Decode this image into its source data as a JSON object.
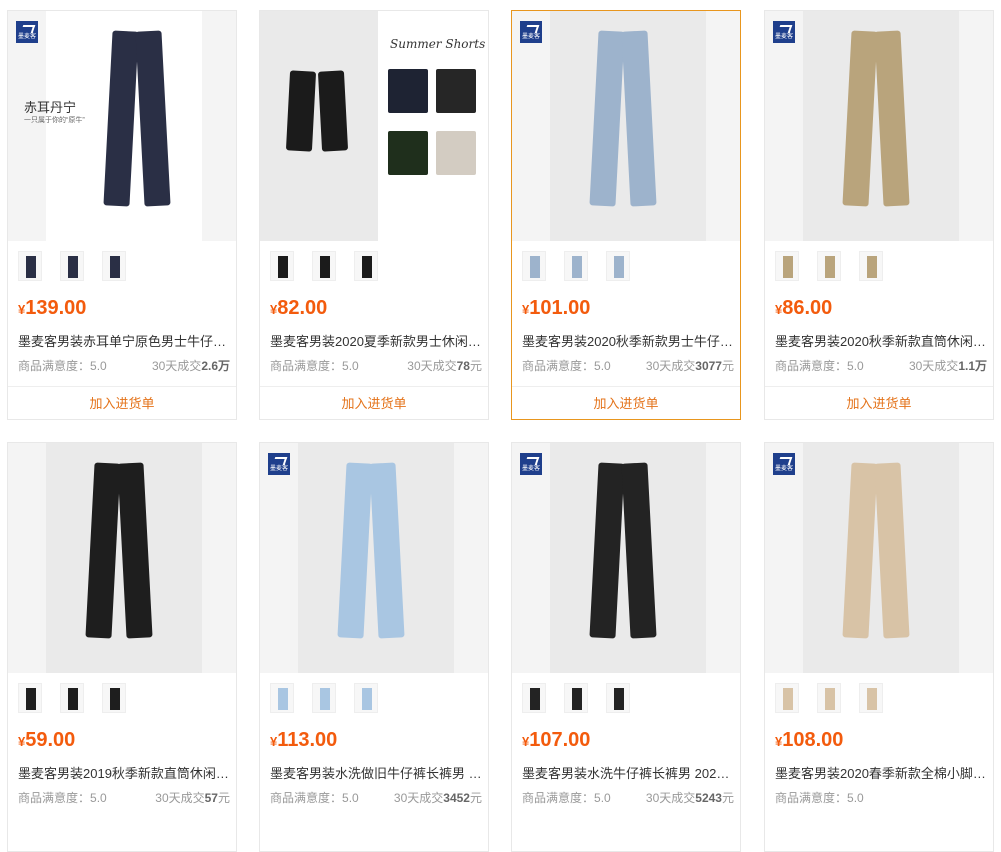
{
  "products": [
    {
      "price_symbol": "¥",
      "price": "139.00",
      "title": "墨麦客男装赤耳单宁原色男士牛仔裤 ...",
      "satisfaction_label": "商品满意度：",
      "satisfaction": "5.0",
      "sales_prefix": "30天成交",
      "sales": "2.6万",
      "sales_suffix": "",
      "button": "加入进货单",
      "photo_text_1": "赤耳丹宁",
      "photo_text_2": "一只属于你的“原牛”",
      "pant_color": "#2a2f45",
      "has_logo": true
    },
    {
      "price_symbol": "¥",
      "price": "82.00",
      "title": "墨麦客男装2020夏季新款男士休闲裤...",
      "satisfaction_label": "商品满意度：",
      "satisfaction": "5.0",
      "sales_prefix": "30天成交",
      "sales": "78",
      "sales_suffix": "元",
      "button": "加入进货单",
      "photo_text_1": "Summer Shorts",
      "photo_text_2": "",
      "pant_color": "#1b1b1b",
      "has_logo": false
    },
    {
      "price_symbol": "¥",
      "price": "101.00",
      "title": "墨麦客男装2020秋季新款男士牛仔裤 ...",
      "satisfaction_label": "商品满意度：",
      "satisfaction": "5.0",
      "sales_prefix": "30天成交",
      "sales": "3077",
      "sales_suffix": "元",
      "button": "加入进货单",
      "photo_text_1": "",
      "photo_text_2": "",
      "pant_color": "#9db3cc",
      "has_logo": true
    },
    {
      "price_symbol": "¥",
      "price": "86.00",
      "title": "墨麦客男装2020秋季新款直筒休闲裤...",
      "satisfaction_label": "商品满意度：",
      "satisfaction": "5.0",
      "sales_prefix": "30天成交",
      "sales": "1.1万",
      "sales_suffix": "",
      "button": "加入进货单",
      "photo_text_1": "",
      "photo_text_2": "",
      "pant_color": "#b9a47c",
      "has_logo": true
    },
    {
      "price_symbol": "¥",
      "price": "59.00",
      "title": "墨麦客男装2019秋季新款直筒休闲裤...",
      "satisfaction_label": "商品满意度：",
      "satisfaction": "5.0",
      "sales_prefix": "30天成交",
      "sales": "57",
      "sales_suffix": "元",
      "button": "",
      "photo_text_1": "",
      "photo_text_2": "",
      "pant_color": "#1e1e1e",
      "has_logo": false
    },
    {
      "price_symbol": "¥",
      "price": "113.00",
      "title": "墨麦客男装水洗做旧牛仔裤长裤男 20...",
      "satisfaction_label": "商品满意度：",
      "satisfaction": "5.0",
      "sales_prefix": "30天成交",
      "sales": "3452",
      "sales_suffix": "元",
      "button": "",
      "photo_text_1": "",
      "photo_text_2": "",
      "pant_color": "#a9c6e2",
      "has_logo": true
    },
    {
      "price_symbol": "¥",
      "price": "107.00",
      "title": "墨麦客男装水洗牛仔裤长裤男 2020年...",
      "satisfaction_label": "商品满意度：",
      "satisfaction": "5.0",
      "sales_prefix": "30天成交",
      "sales": "5243",
      "sales_suffix": "元",
      "button": "",
      "photo_text_1": "",
      "photo_text_2": "",
      "pant_color": "#232323",
      "has_logo": true
    },
    {
      "price_symbol": "¥",
      "price": "108.00",
      "title": "墨麦客男装2020春季新款全棉小脚牛...",
      "satisfaction_label": "商品满意度：",
      "satisfaction": "5.0",
      "sales_prefix": "",
      "sales": "",
      "sales_suffix": "",
      "button": "",
      "photo_text_1": "",
      "photo_text_2": "",
      "pant_color": "#d8c3a6",
      "has_logo": true
    }
  ],
  "brand_logo_text": "墨麦客",
  "accent_color": "#f35b0d",
  "button_color": "#e4731a",
  "active_border_color": "#e8961e"
}
